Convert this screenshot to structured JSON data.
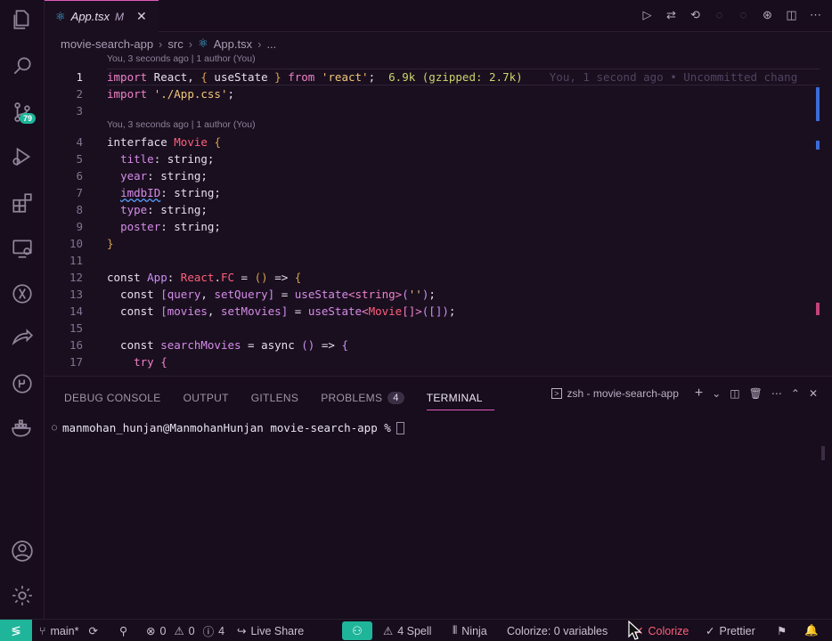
{
  "activity_bar": {
    "items": [
      {
        "name": "explorer-icon"
      },
      {
        "name": "search-icon"
      },
      {
        "name": "source-control-icon",
        "badge": "79"
      },
      {
        "name": "run-debug-icon"
      },
      {
        "name": "extensions-icon"
      },
      {
        "name": "remote-explorer-icon"
      },
      {
        "name": "testing-icon"
      },
      {
        "name": "live-share-icon"
      },
      {
        "name": "gitlens-icon"
      },
      {
        "name": "docker-icon"
      }
    ],
    "bottom": [
      {
        "name": "accounts-icon"
      },
      {
        "name": "settings-gear-icon"
      }
    ]
  },
  "tab": {
    "name": "App.tsx",
    "modified": "M"
  },
  "breadcrumb": {
    "items": [
      "movie-search-app",
      "src",
      "App.tsx",
      "..."
    ]
  },
  "editor": {
    "lens1": "You, 3 seconds ago | 1 author (You)",
    "lens2": "You, 3 seconds ago | 1 author (You)",
    "import_cost": "6.9k (gzipped: 2.7k)",
    "blame": "You, 1 second ago • Uncommitted chang",
    "line_numbers": [
      "1",
      "2",
      "3",
      "4",
      "5",
      "6",
      "7",
      "8",
      "9",
      "10",
      "11",
      "12",
      "13",
      "14",
      "15",
      "16",
      "17"
    ]
  },
  "panel": {
    "tabs": [
      "DEBUG CONSOLE",
      "OUTPUT",
      "GITLENS",
      "PROBLEMS",
      "TERMINAL"
    ],
    "problems_count": "4",
    "terminal_name": "zsh - movie-search-app",
    "prompt": "manmohan_hunjan@ManmohanHunjan movie-search-app %"
  },
  "status_bar": {
    "branch": "main*",
    "errors": "0",
    "warnings": "0",
    "info": "4",
    "live_share": "Live Share",
    "spell": "4 Spell",
    "ninja": "Ninja",
    "colorize_vars": "Colorize: 0 variables",
    "colorize": "Colorize",
    "prettier": "Prettier"
  },
  "colors": {
    "accent": "#1fb59a",
    "tab_border": "#e15ab8",
    "background": "#1a0f1f"
  }
}
